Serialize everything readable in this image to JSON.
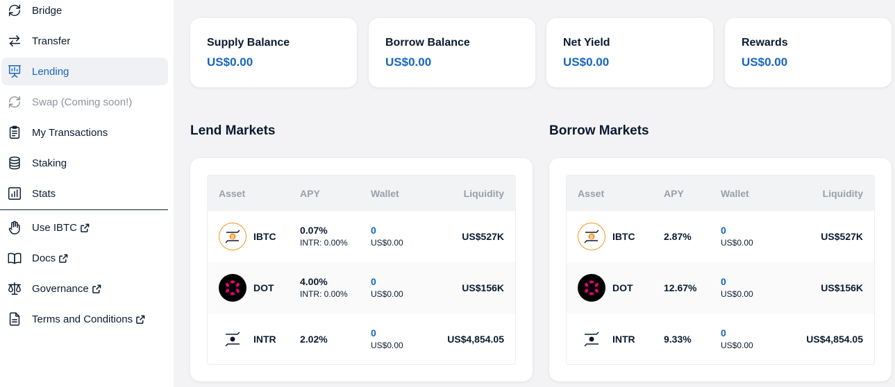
{
  "sidebar": {
    "items": [
      {
        "label": "Bridge",
        "icon": "refresh-icon"
      },
      {
        "label": "Transfer",
        "icon": "swap-arrows-icon"
      },
      {
        "label": "Lending",
        "icon": "presentation-chart-icon"
      },
      {
        "label": "Swap (Coming soon!)",
        "icon": "refresh-icon"
      },
      {
        "label": "My Transactions",
        "icon": "clipboard-icon"
      },
      {
        "label": "Staking",
        "icon": "database-icon"
      },
      {
        "label": "Stats",
        "icon": "bar-chart-icon"
      },
      {
        "label": "Use IBTC",
        "icon": "hand-icon"
      },
      {
        "label": "Docs",
        "icon": "book-icon"
      },
      {
        "label": "Governance",
        "icon": "scale-icon"
      },
      {
        "label": "Terms and Conditions",
        "icon": "document-icon"
      }
    ]
  },
  "summary": {
    "supply": {
      "label": "Supply Balance",
      "value": "US$0.00"
    },
    "borrow": {
      "label": "Borrow Balance",
      "value": "US$0.00"
    },
    "net_yield": {
      "label": "Net Yield",
      "value": "US$0.00"
    },
    "rewards": {
      "label": "Rewards",
      "value": "US$0.00"
    }
  },
  "lend": {
    "title": "Lend Markets",
    "headers": {
      "asset": "Asset",
      "apy": "APY",
      "wallet": "Wallet",
      "liquidity": "Liquidity"
    },
    "rows": [
      {
        "asset": "IBTC",
        "apy": "0.07%",
        "apy_sub": "INTR: 0.00%",
        "wallet": "0",
        "wallet_sub": "US$0.00",
        "liquidity": "US$527K"
      },
      {
        "asset": "DOT",
        "apy": "4.00%",
        "apy_sub": "INTR: 0.00%",
        "wallet": "0",
        "wallet_sub": "US$0.00",
        "liquidity": "US$156K"
      },
      {
        "asset": "INTR",
        "apy": "2.02%",
        "wallet": "0",
        "wallet_sub": "US$0.00",
        "liquidity": "US$4,854.05"
      }
    ]
  },
  "borrow": {
    "title": "Borrow Markets",
    "headers": {
      "asset": "Asset",
      "apy": "APY",
      "wallet": "Wallet",
      "liquidity": "Liquidity"
    },
    "rows": [
      {
        "asset": "IBTC",
        "apy": "2.87%",
        "wallet": "0",
        "wallet_sub": "US$0.00",
        "liquidity": "US$527K"
      },
      {
        "asset": "DOT",
        "apy": "12.67%",
        "wallet": "0",
        "wallet_sub": "US$0.00",
        "liquidity": "US$156K"
      },
      {
        "asset": "INTR",
        "apy": "9.33%",
        "wallet": "0",
        "wallet_sub": "US$0.00",
        "liquidity": "US$4,854.05"
      }
    ]
  },
  "colors": {
    "accent": "#1565c0",
    "ibtc": "#f7931a",
    "dot": "#e6007a",
    "text": "#0b1a2e"
  }
}
